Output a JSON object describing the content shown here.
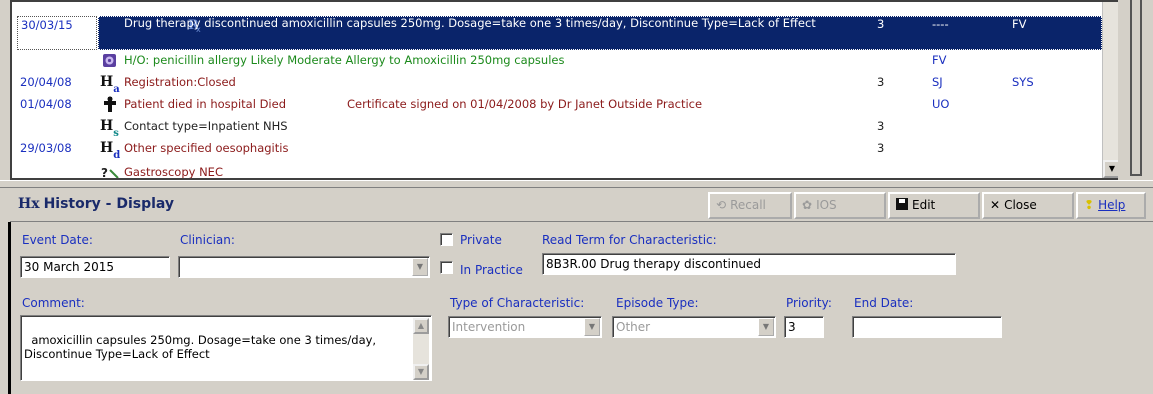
{
  "journal": {
    "rows": [
      {
        "date": "30/03/15",
        "icon": "rx-icon",
        "desc": "Drug therapy discontinued amoxicillin capsules 250mg. Dosage=take one 3 times/day, Discontinue Type=Lack of Effect",
        "priority": "3",
        "col1": "----",
        "col2": "FV",
        "selected": true
      },
      {
        "date": "",
        "icon": "allergy-icon",
        "desc": "H/O: penicillin allergy Likely Moderate Allergy to Amoxicillin 250mg capsules",
        "priority": "",
        "col1": "FV",
        "col2": ""
      },
      {
        "date": "20/04/08",
        "icon": "h-a-icon",
        "desc": "Registration:Closed",
        "priority": "3",
        "col1": "SJ",
        "col2": "SYS"
      },
      {
        "date": "01/04/08",
        "icon": "death-icon",
        "desc": "Patient died in hospital  Died",
        "desc2": "Certificate signed on 01/04/2008 by Dr Janet Outside Practice",
        "priority": "",
        "col1": "UO",
        "col2": ""
      },
      {
        "date": "",
        "icon": "h-s-icon",
        "desc": "Contact type=Inpatient NHS",
        "priority": "3",
        "col1": "",
        "col2": ""
      },
      {
        "date": "29/03/08",
        "icon": "h-d-icon",
        "desc": "Other specified oesophagitis",
        "priority": "3",
        "col1": "",
        "col2": ""
      },
      {
        "date": "",
        "icon": "procedure-icon",
        "desc": "Gastroscopy NEC",
        "priority": "",
        "col1": "",
        "col2": ""
      }
    ]
  },
  "toolbar": {
    "title": "History - Display",
    "title_glyph": "Hx",
    "recall_label": "Recall",
    "ios_label": "IOS",
    "edit_label": "Edit",
    "close_label": "Close",
    "help_label": "Help"
  },
  "form": {
    "event_date_label": "Event Date:",
    "event_date_value": "30 March 2015",
    "clinician_label": "Clinician:",
    "clinician_value": "",
    "private_label": "Private",
    "in_practice_label": "In Practice",
    "read_term_label": "Read Term for Characteristic:",
    "read_term_value": "8B3R.00 Drug therapy discontinued",
    "comment_label": "Comment:",
    "comment_value": "amoxicillin capsules 250mg. Dosage=take one 3 times/day,\nDiscontinue Type=Lack of Effect",
    "type_char_label": "Type of Characteristic:",
    "type_char_value": "Intervention",
    "episode_type_label": "Episode Type:",
    "episode_type_value": "Other",
    "priority_label": "Priority:",
    "priority_value": "3",
    "end_date_label": "End Date:",
    "end_date_value": ""
  }
}
